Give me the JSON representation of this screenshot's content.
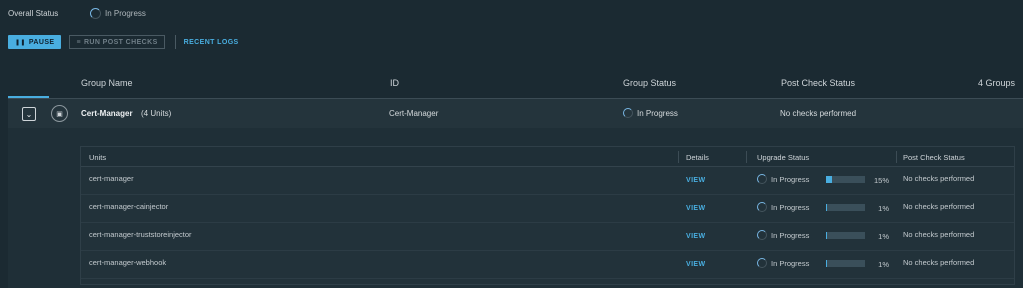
{
  "overall": {
    "label": "Overall Status",
    "status": "In Progress"
  },
  "actions": {
    "pause_label": "PAUSE",
    "post_checks_label": "RUN POST CHECKS",
    "recent_logs_label": "RECENT LOGS"
  },
  "groups_table": {
    "columns": [
      "Group Name",
      "ID",
      "Group Status",
      "Post Check Status"
    ],
    "count_label": "4 Groups",
    "group": {
      "name": "Cert-Manager",
      "units": "(4 Units)",
      "id": "Cert-Manager",
      "status": "In Progress",
      "post_check": "No checks performed"
    }
  },
  "units_table": {
    "columns": [
      "Units",
      "Details",
      "Upgrade Status",
      "Post Check Status"
    ],
    "rows": [
      {
        "unit": "cert-manager",
        "details": "VIEW",
        "status": "In Progress",
        "progress": 15,
        "percent": "15%",
        "post_check": "No checks performed"
      },
      {
        "unit": "cert-manager-cainjector",
        "details": "VIEW",
        "status": "In Progress",
        "progress": 1,
        "percent": "1%",
        "post_check": "No checks performed"
      },
      {
        "unit": "cert-manager-truststoreinjector",
        "details": "VIEW",
        "status": "In Progress",
        "progress": 1,
        "percent": "1%",
        "post_check": "No checks performed"
      },
      {
        "unit": "cert-manager-webhook",
        "details": "VIEW",
        "status": "In Progress",
        "progress": 1,
        "percent": "1%",
        "post_check": "No checks performed"
      }
    ]
  },
  "colors": {
    "accent": "#49aee0",
    "background": "#1b2a32"
  }
}
